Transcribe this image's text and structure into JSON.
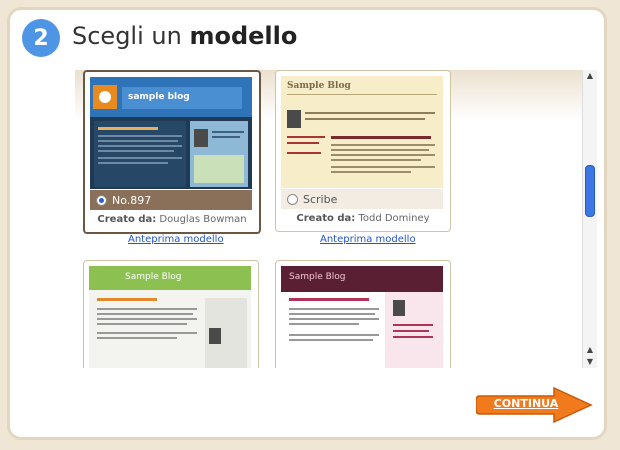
{
  "step": {
    "number": "2",
    "title_prefix": "Scegli un",
    "title_bold": "modello"
  },
  "templates": [
    {
      "name": "No.897",
      "author_label": "Creato da:",
      "author": "Douglas Bowman",
      "preview_link": "Anteprima modello",
      "selected": true,
      "thumb_title": "sample blog"
    },
    {
      "name": "Scribe",
      "author_label": "Creato da:",
      "author": "Todd Dominey",
      "preview_link": "Anteprima modello",
      "selected": false,
      "thumb_title": "Sample Blog"
    },
    {
      "thumb_title": "Sample Blog"
    },
    {
      "thumb_title": "Sample Blog"
    }
  ],
  "continue_label": "CONTINUA",
  "colors": {
    "accent_blue": "#4f95e6",
    "continue_orange": "#f07a1c",
    "link": "#2255cc"
  }
}
